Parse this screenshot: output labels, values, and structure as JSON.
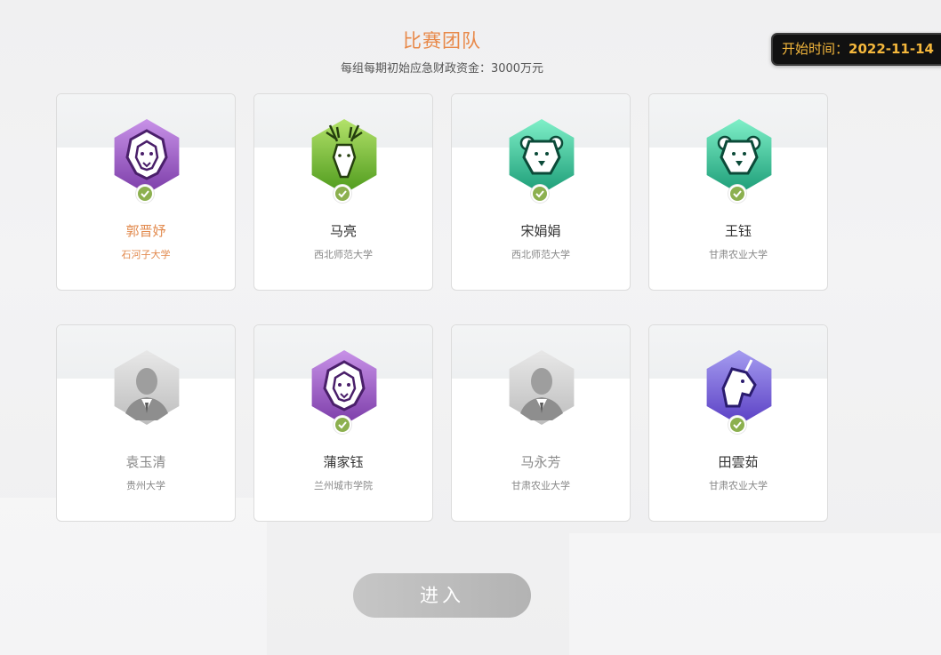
{
  "header": {
    "title": "比赛团队",
    "subtitle": "每组每期初始应急财政资金：3000万元"
  },
  "start_time": {
    "label": "开始时间：",
    "date": "2022-11-14"
  },
  "members": [
    {
      "name": "郭晋妤",
      "school": "石河子大学",
      "avatar": "lion-icon",
      "status": "ready",
      "selected": true
    },
    {
      "name": "马亮",
      "school": "西北师范大学",
      "avatar": "deer-icon",
      "status": "ready",
      "selected": false
    },
    {
      "name": "宋娟娟",
      "school": "西北师范大学",
      "avatar": "bear-icon",
      "status": "ready",
      "selected": false
    },
    {
      "name": "王钰",
      "school": "甘肃农业大学",
      "avatar": "bear-icon",
      "status": "ready",
      "selected": false
    },
    {
      "name": "袁玉清",
      "school": "贵州大学",
      "avatar": "default-user-icon",
      "status": "pending",
      "selected": false
    },
    {
      "name": "蒲家钰",
      "school": "兰州城市学院",
      "avatar": "lion-icon",
      "status": "ready",
      "selected": false
    },
    {
      "name": "马永芳",
      "school": "甘肃农业大学",
      "avatar": "default-user-icon",
      "status": "pending",
      "selected": false
    },
    {
      "name": "田雲茹",
      "school": "甘肃农业大学",
      "avatar": "unicorn-icon",
      "status": "ready",
      "selected": false
    }
  ],
  "enter_button": {
    "label": "进入"
  },
  "colors": {
    "accent": "#e8894a",
    "badge_text": "#f4b73c",
    "check": "#8cb04f"
  }
}
